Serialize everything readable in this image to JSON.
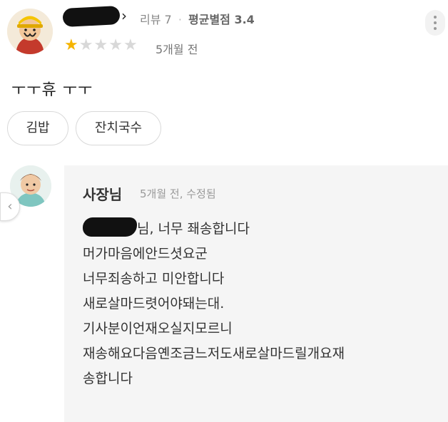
{
  "review": {
    "chevron": "›",
    "review_count": "리뷰 7",
    "dot": "·",
    "avg_rating": "평균별점 3.4",
    "rating": 1,
    "max_rating": 5,
    "age": "5개월 전",
    "text": "ㅜㅜ휴 ㅜㅜ",
    "menu_tags": [
      "김밥",
      "잔치국수"
    ]
  },
  "owner_reply": {
    "name": "사장님",
    "meta": "5개월 전, 수정됨",
    "lines": [
      "님, 너무 좨송합니다",
      "머가마음에안드셧요군",
      "너무죄송하고 미안합니다",
      "새로살마드렷어야돼는대.",
      "기사분이언재오실지모르니",
      "재송해요다음옌조금느저도새로살마드릴개요재",
      "송합니다"
    ]
  },
  "nav": {
    "prev_arrow": "‹"
  },
  "colors": {
    "star": "#f5b400",
    "star_empty": "#d8d8d8",
    "reply_bg": "#f5f5f5"
  }
}
